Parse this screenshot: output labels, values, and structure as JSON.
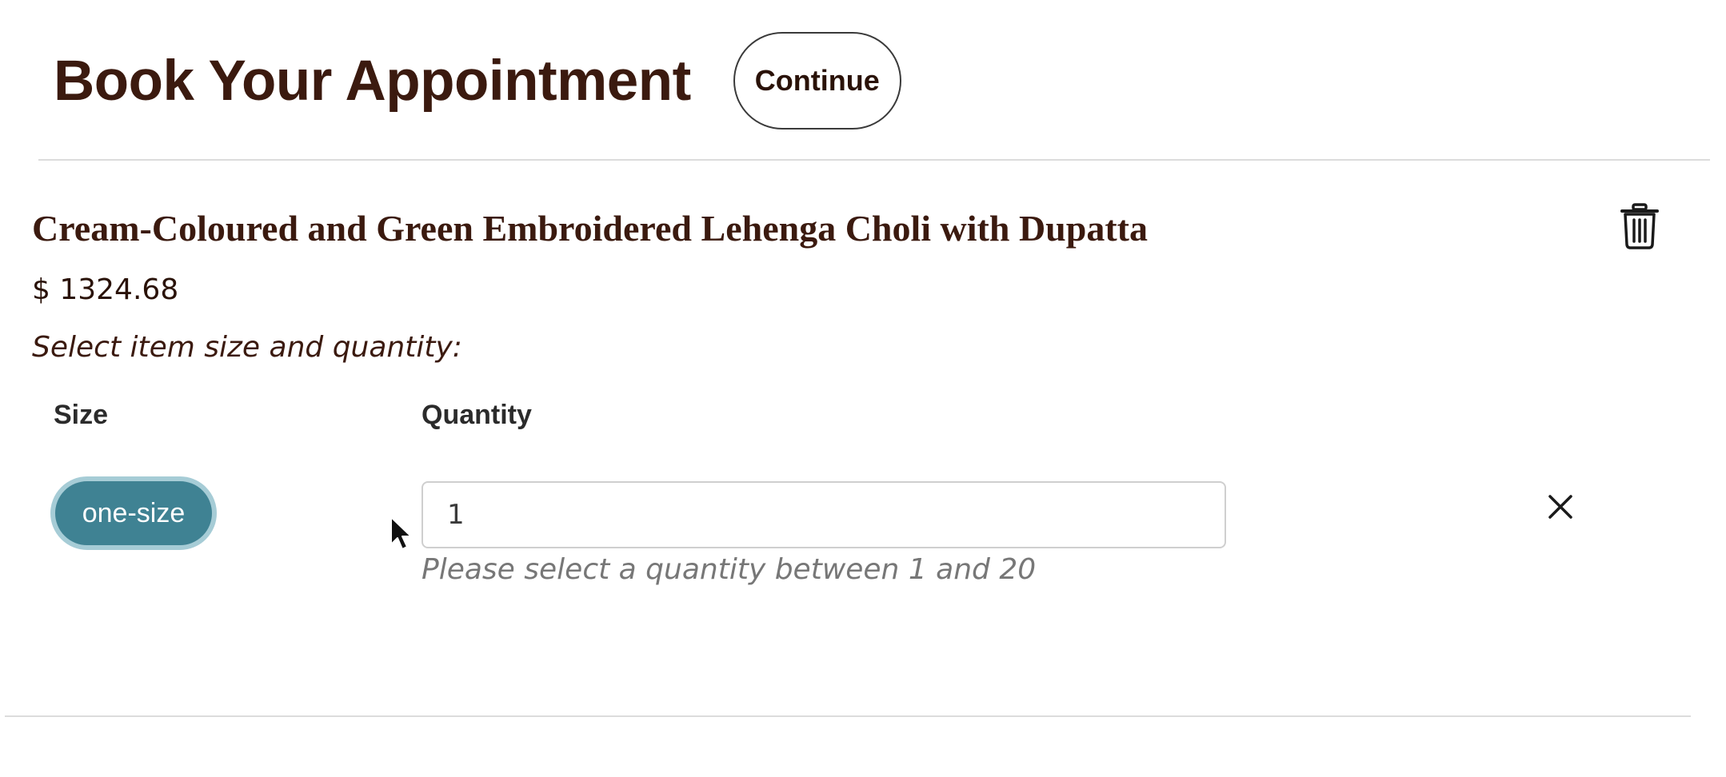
{
  "header": {
    "title": "Book Your Appointment",
    "continue_label": "Continue"
  },
  "product": {
    "name": "Cream-Coloured and Green Embroidered Lehenga Choli with Dupatta",
    "price": "$ 1324.68",
    "instruction": "Select item size and quantity:",
    "delete_icon": "trash-icon"
  },
  "selection": {
    "size_header": "Size",
    "quantity_header": "Quantity",
    "size_value": "one-size",
    "quantity_value": "1",
    "quantity_help": "Please select a quantity between 1 and 20",
    "remove_icon": "close-icon"
  },
  "colors": {
    "text_primary": "#3b1a0f",
    "size_pill_bg": "#3f8293",
    "size_pill_ring": "#a6ccd6",
    "help_text": "#777777"
  }
}
